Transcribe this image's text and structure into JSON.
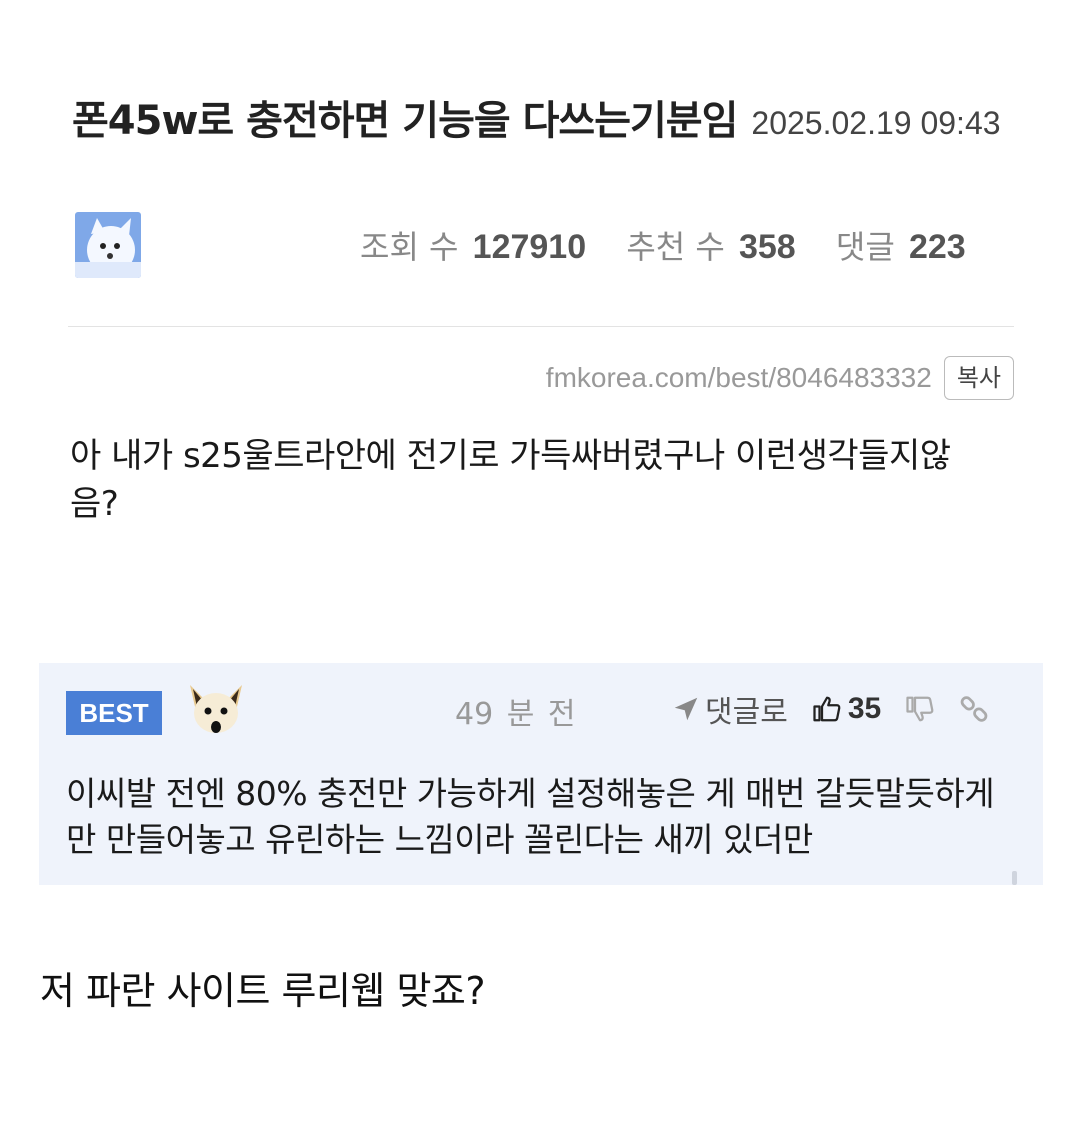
{
  "post": {
    "title": "폰45w로 충전하면 기능을 다쓰는기분임",
    "date": "2025.02.19 09:43",
    "stats": {
      "views_label": "조회 수",
      "views": "127910",
      "recommend_label": "추천 수",
      "recommend": "358",
      "comments_label": "댓글",
      "comments": "223"
    },
    "url": "fmkorea.com/best/8046483332",
    "copy_label": "복사",
    "body": "아 내가 s25울트라안에 전기로 가득싸버렸구나 이런생각들지않음?"
  },
  "best_comment": {
    "badge": "BEST",
    "time": "49 분 전",
    "reply_label": "댓글로",
    "upvotes": "35",
    "text": "이씨발 전엔 80% 충전만 가능하게 설정해놓은 게 매번 갈듯말듯하게만 만들어놓고 유린하는 느낌이라 꼴린다는 새끼 있더만",
    "badge_color": "#4a7fd6",
    "background_color": "#eff3fb"
  },
  "icons": {
    "reply": "send-arrow-icon",
    "upvote": "thumbs-up-icon",
    "downvote": "thumbs-down-icon",
    "link": "link-icon"
  },
  "caption": "저 파란 사이트 루리웹 맞죠?"
}
